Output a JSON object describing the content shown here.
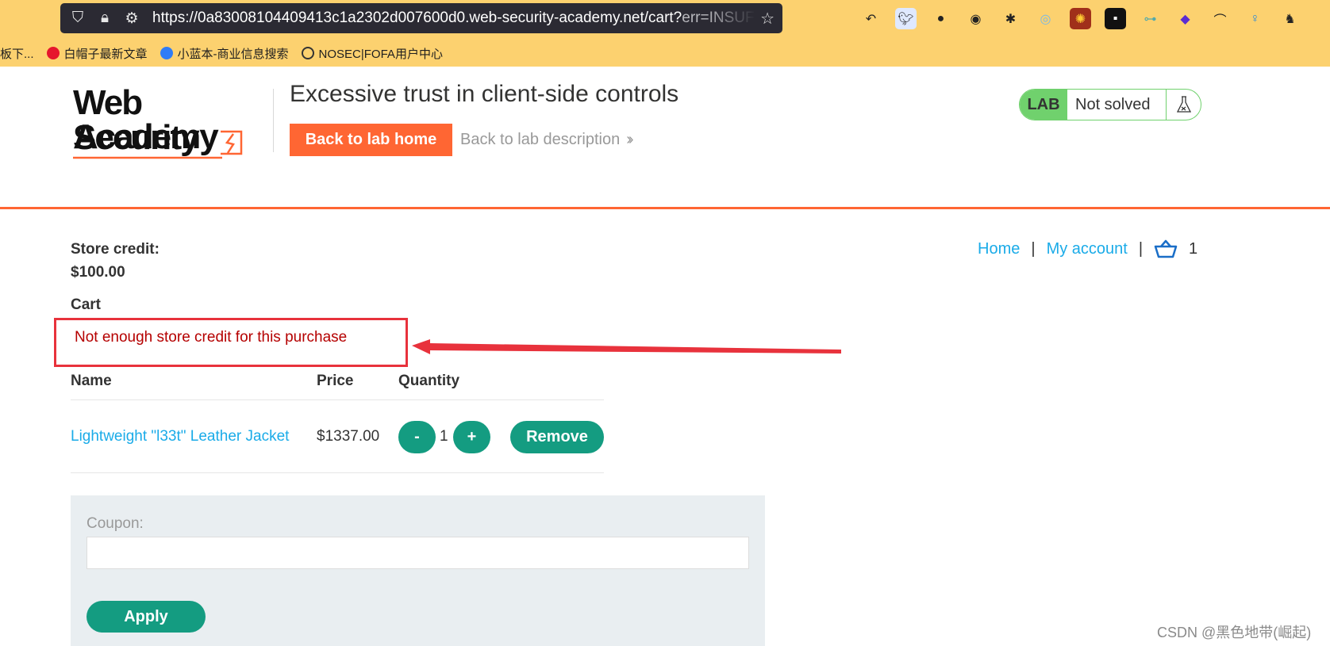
{
  "browser": {
    "url_main": "https://0a83008104409413c1a2302d007600d0.web-security-academy.net/cart?",
    "url_query": "err=INSUFFICIENT",
    "bookmarks": [
      {
        "label": "板下...",
        "icon": ""
      },
      {
        "label": "白帽子最新文章",
        "icon": "weibo-icon"
      },
      {
        "label": "小蓝本-商业信息搜索",
        "icon": "search-q-icon"
      },
      {
        "label": "NOSEC|FOFA用户中心",
        "icon": "globe-icon"
      }
    ]
  },
  "header": {
    "logo_line1": "Web Security",
    "logo_line2": "Academy",
    "lab_title": "Excessive trust in client-side controls",
    "back_home": "Back to lab home",
    "back_desc": "Back to lab description",
    "lab_badge": "LAB",
    "lab_state": "Not solved"
  },
  "account": {
    "credit_label": "Store credit:",
    "credit_value": "$100.00",
    "cart_heading": "Cart",
    "error_message": "Not enough store credit for this purchase"
  },
  "nav": {
    "home": "Home",
    "separator": "|",
    "my_account": "My account",
    "cart_count": "1"
  },
  "cart": {
    "columns": [
      "Name",
      "Price",
      "Quantity"
    ],
    "items": [
      {
        "name": "Lightweight \"l33t\" Leather Jacket",
        "price": "$1337.00",
        "quantity": "1"
      }
    ],
    "minus": "-",
    "plus": "+",
    "remove": "Remove"
  },
  "coupon": {
    "label": "Coupon:",
    "value": "",
    "apply": "Apply"
  },
  "watermark": "CSDN @黑色地带(崛起)",
  "colors": {
    "accent_orange": "#ff6633",
    "button_green": "#149c81",
    "lab_green": "#70d16d",
    "link_blue": "#1aabe8",
    "error_red": "#b50000",
    "annotation_red": "#e8323c"
  }
}
